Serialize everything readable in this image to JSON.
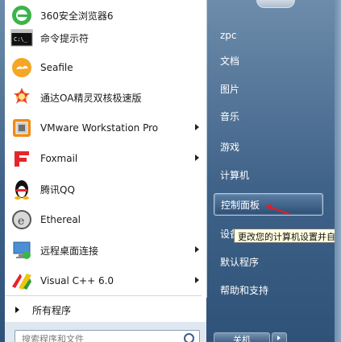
{
  "programs": [
    {
      "label": "360安全浏览器6",
      "icon": "360-browser-icon",
      "submenu": false
    },
    {
      "label": "命令提示符",
      "icon": "cmd-icon",
      "submenu": false
    },
    {
      "label": "Seafile",
      "icon": "seafile-icon",
      "submenu": false
    },
    {
      "label": "通达OA精灵双核极速版",
      "icon": "tongda-oa-icon",
      "submenu": false
    },
    {
      "label": "VMware Workstation Pro",
      "icon": "vmware-icon",
      "submenu": true
    },
    {
      "label": "Foxmail",
      "icon": "foxmail-icon",
      "submenu": true
    },
    {
      "label": "腾讯QQ",
      "icon": "qq-icon",
      "submenu": false
    },
    {
      "label": "Ethereal",
      "icon": "ethereal-icon",
      "submenu": false
    },
    {
      "label": "远程桌面连接",
      "icon": "remote-desktop-icon",
      "submenu": true
    },
    {
      "label": "Visual C++ 6.0",
      "icon": "visual-cpp-icon",
      "submenu": true
    }
  ],
  "all_programs_label": "所有程序",
  "search_placeholder": "搜索程序和文件",
  "right_items": [
    {
      "label": "zpc",
      "highlight": false
    },
    {
      "label": "文档",
      "highlight": false
    },
    {
      "label": "图片",
      "highlight": false
    },
    {
      "label": "音乐",
      "highlight": false
    },
    {
      "label": "游戏",
      "highlight": false
    },
    {
      "label": "计算机",
      "highlight": false
    },
    {
      "label": "控制面板",
      "highlight": true
    },
    {
      "label": "设备",
      "highlight": false
    },
    {
      "label": "默认程序",
      "highlight": false
    },
    {
      "label": "帮助和支持",
      "highlight": false
    }
  ],
  "tooltip": "更改您的计算机设置并自",
  "shutdown_label": "关机",
  "colors": {
    "accent": "#2d4f76",
    "tooltip_bg": "#ffffe1"
  }
}
